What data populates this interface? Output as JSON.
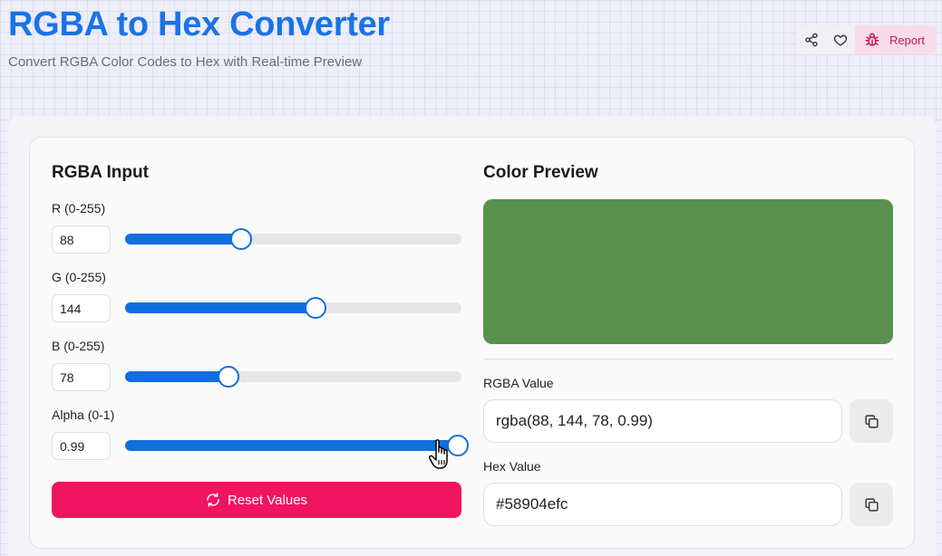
{
  "header": {
    "title": "RGBA to Hex Converter",
    "subtitle": "Convert RGBA Color Codes to Hex with Real-time Preview",
    "report_label": "Report",
    "share_icon": "share-icon",
    "heart_icon": "heart-icon",
    "bug_icon": "bug-icon"
  },
  "input": {
    "heading": "RGBA Input",
    "r_label": "R (0-255)",
    "r_value": "88",
    "r_fraction": 0.345,
    "g_label": "G (0-255)",
    "g_value": "144",
    "g_fraction": 0.565,
    "b_label": "B (0-255)",
    "b_value": "78",
    "b_fraction": 0.306,
    "a_label": "Alpha (0-1)",
    "a_value": "0.99",
    "a_fraction": 0.99,
    "reset_label": "Reset Values"
  },
  "preview": {
    "heading": "Color Preview",
    "color": "#5a904e",
    "rgba_label": "RGBA Value",
    "rgba_value": "rgba(88, 144, 78, 0.99)",
    "hex_label": "Hex Value",
    "hex_value": "#58904efc"
  },
  "colors": {
    "accent": "#0f6fde",
    "title": "#1a73e8",
    "reset": "#f01461",
    "report_bg": "#f8dde8"
  }
}
